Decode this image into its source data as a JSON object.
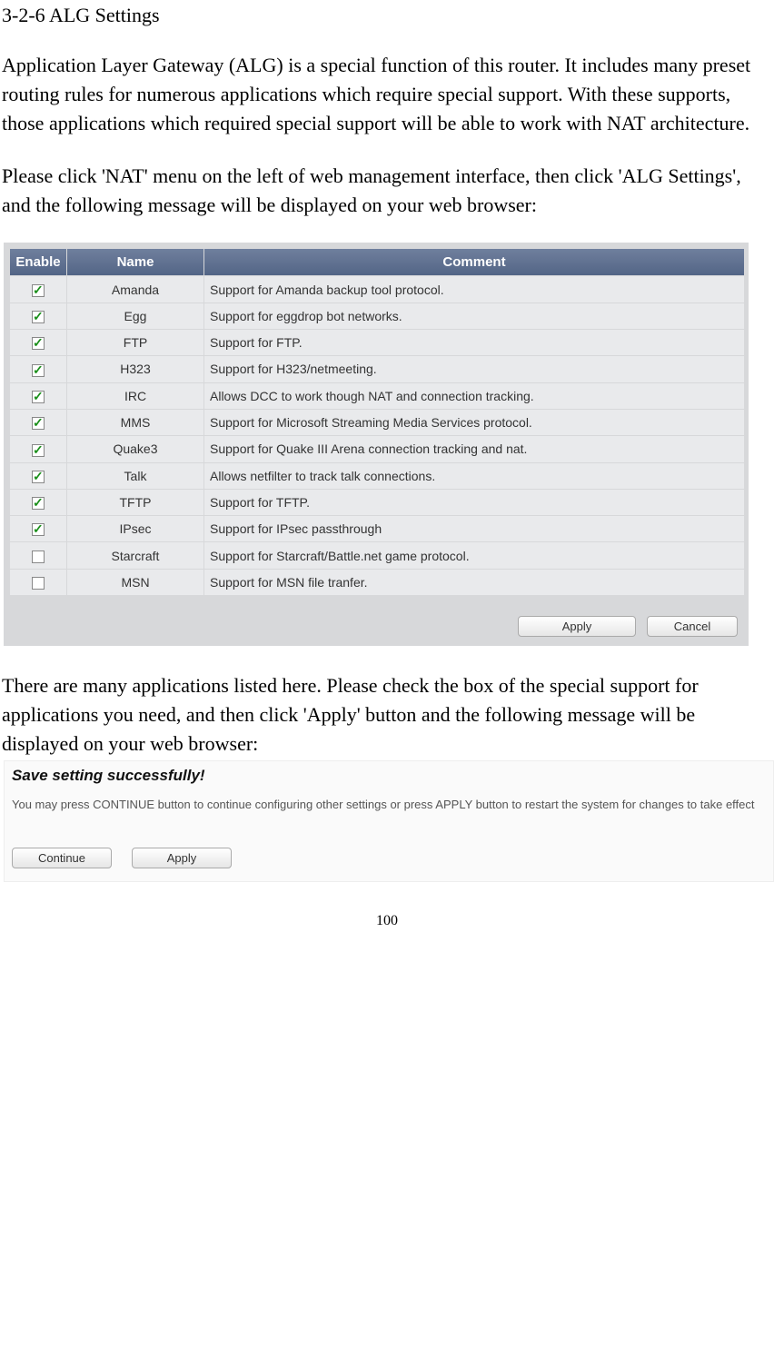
{
  "heading": "3-2-6 ALG Settings",
  "paragraph1": "Application Layer Gateway (ALG) is a special function of this router. It includes many preset routing rules for numerous applications which require special support. With these supports, those applications which required special support will be able to work with NAT architecture.",
  "paragraph2": "Please click 'NAT' menu on the left of web management interface, then click 'ALG Settings', and the following message will be displayed on your web browser:",
  "table": {
    "headers": {
      "enable": "Enable",
      "name": "Name",
      "comment": "Comment"
    },
    "rows": [
      {
        "checked": true,
        "name": "Amanda",
        "comment": "Support for Amanda backup tool protocol."
      },
      {
        "checked": true,
        "name": "Egg",
        "comment": "Support for eggdrop bot networks."
      },
      {
        "checked": true,
        "name": "FTP",
        "comment": "Support for FTP."
      },
      {
        "checked": true,
        "name": "H323",
        "comment": "Support for H323/netmeeting."
      },
      {
        "checked": true,
        "name": "IRC",
        "comment": " Allows DCC to work though NAT and connection tracking."
      },
      {
        "checked": true,
        "name": "MMS",
        "comment": " Support for Microsoft Streaming Media Services protocol."
      },
      {
        "checked": true,
        "name": "Quake3",
        "comment": "Support for Quake III Arena connection tracking and nat."
      },
      {
        "checked": true,
        "name": "Talk",
        "comment": "Allows netfilter to track talk connections."
      },
      {
        "checked": true,
        "name": "TFTP",
        "comment": "Support for TFTP."
      },
      {
        "checked": true,
        "name": "IPsec",
        "comment": "Support for IPsec passthrough"
      },
      {
        "checked": false,
        "name": "Starcraft",
        "comment": "Support for Starcraft/Battle.net game protocol."
      },
      {
        "checked": false,
        "name": "MSN",
        "comment": "Support for MSN file tranfer."
      }
    ]
  },
  "buttons": {
    "apply": "Apply",
    "cancel": "Cancel"
  },
  "paragraph3": "There are many applications listed here. Please check the box of the special support for applications you need, and then click 'Apply' button and the following message will be displayed on your web browser:",
  "savebox": {
    "title": "Save setting successfully!",
    "text": "You may press CONTINUE button to continue configuring other settings or press APPLY button to restart the system for changes to take effect",
    "continue": "Continue",
    "apply": "Apply"
  },
  "page_number": "100"
}
